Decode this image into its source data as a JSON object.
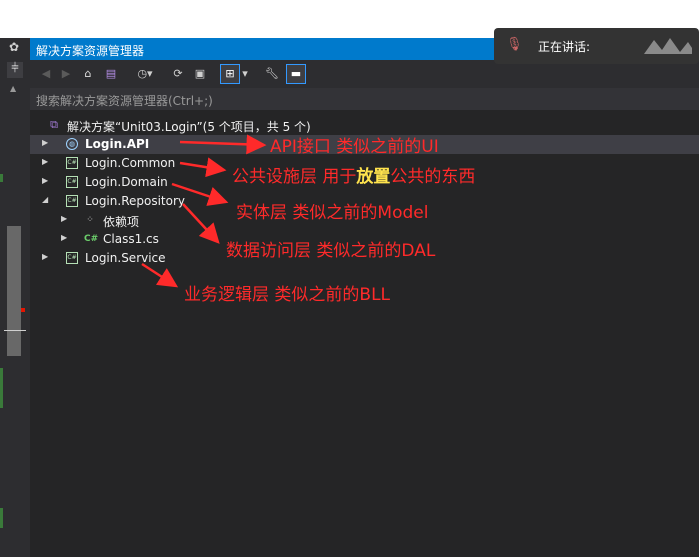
{
  "panel": {
    "title": "解决方案资源管理器",
    "search_placeholder": "搜索解决方案资源管理器(Ctrl+;)"
  },
  "notification": {
    "text": "正在讲话:"
  },
  "tree": {
    "solution": "解决方案“Unit03.Login”(5 个项目，共 5 个)",
    "items": [
      {
        "label": "Login.API"
      },
      {
        "label": "Login.Common"
      },
      {
        "label": "Login.Domain"
      },
      {
        "label": "Login.Repository"
      },
      {
        "label": "依赖项"
      },
      {
        "label": "Class1.cs"
      },
      {
        "label": "Login.Service"
      }
    ]
  },
  "annotations": {
    "api": "API接口   类似之前的UI",
    "common_pre": "公共设施层  用于",
    "common_hl": "放置",
    "common_post": "公共的东西",
    "domain": "实体层  类似之前的Model",
    "repository": "数据访问层   类似之前的DAL",
    "service": "业务逻辑层  类似之前的BLL"
  },
  "colors": {
    "accent": "#007acc",
    "panel_bg": "#252526",
    "annotation": "#ff2a2a",
    "highlight": "#ffe34d"
  }
}
